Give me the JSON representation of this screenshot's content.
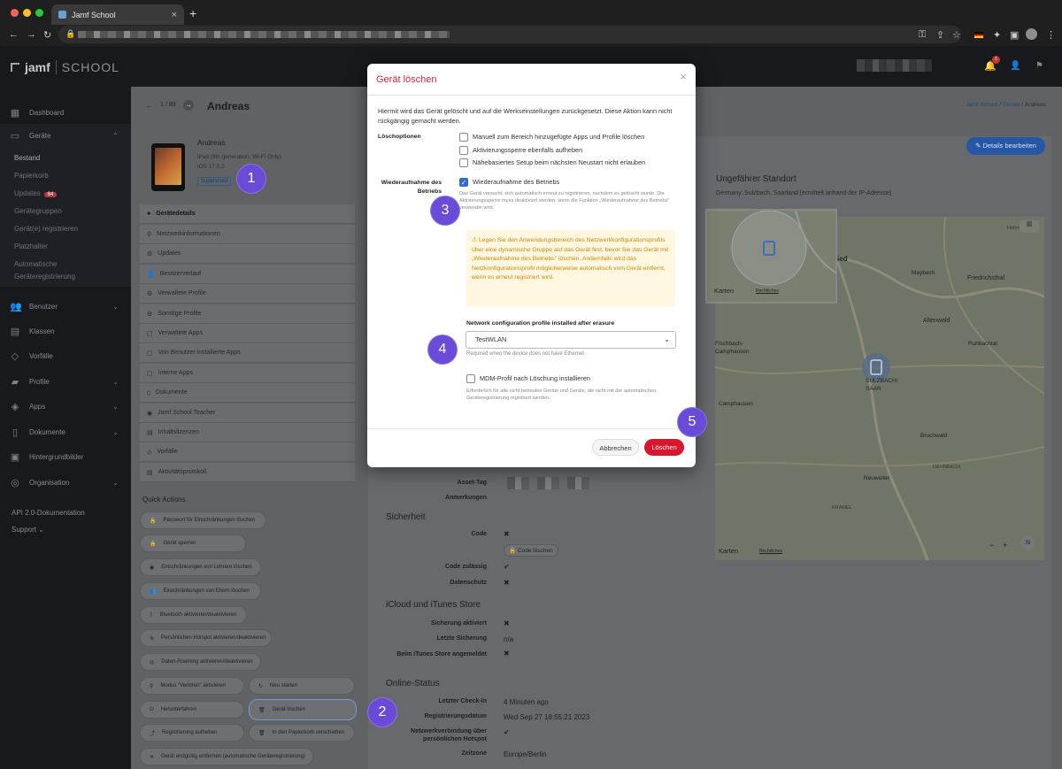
{
  "browser": {
    "tab_title": "Jamf School",
    "close": "×",
    "new_tab": "+"
  },
  "app": {
    "logo_jamf": "jamf",
    "logo_school": "SCHOOL",
    "notifications": "1"
  },
  "sidebar": {
    "items": [
      {
        "label": "Dashboard",
        "icon": "grid-icon"
      },
      {
        "label": "Geräte",
        "icon": "monitor-icon"
      },
      {
        "label": "Benutzer",
        "icon": "users-icon"
      },
      {
        "label": "Klassen",
        "icon": "book-icon"
      },
      {
        "label": "Vorfälle",
        "icon": "tag-icon"
      },
      {
        "label": "Profile",
        "icon": "folder-icon"
      },
      {
        "label": "Apps",
        "icon": "layers-icon"
      },
      {
        "label": "Dokumente",
        "icon": "document-icon"
      },
      {
        "label": "Hintergrundbilder",
        "icon": "image-icon"
      },
      {
        "label": "Organisation",
        "icon": "globe-icon"
      }
    ],
    "sub": [
      "Bestand",
      "Papierkorb",
      "Updates",
      "Gerätegruppen",
      "Gerät(e) registrieren",
      "Platzhalter",
      "Automatische",
      "Geräteregistrierung"
    ],
    "updates_badge": "84",
    "api_docs": "API 2.0-Dokumentation",
    "support": "Support"
  },
  "device": {
    "pager": "1 / 89",
    "name": "Andreas",
    "name_small": "Andreas",
    "model": "iPad (8th generation, Wi-Fi Only)",
    "ios": "iOS 17.0.2",
    "supervised": "Supervised",
    "breadcrumb": [
      "Jamf School",
      "Geräte",
      "Andreas"
    ],
    "edit_button": "Details bearbeiten"
  },
  "device_menu": [
    "Gerätedetails",
    "Netzwerkinformationen",
    "Updates",
    "Besitzerverlauf",
    "Verwaltete Profile",
    "Sonstige Profile",
    "Verwaltete Apps",
    "Von Benutzer installierte Apps",
    "Interne Apps",
    "Dokumente",
    "Jamf School Teacher",
    "Inhaltslizenzen",
    "Vorfälle",
    "Aktivitätsprotokoll"
  ],
  "quick_actions": {
    "title": "Quick Actions",
    "items": [
      "Passwort für Einschränkungen löschen",
      "Gerät sperren",
      "Einschränkungen von Lehrern löschen",
      "Einschränkungen von Eltern löschen",
      "Bluetooth aktivieren/deaktivieren",
      "Persönlichen Hotspot aktivieren/deaktivieren",
      "Daten-Roaming aktivieren/deaktivieren",
      "Modus \"Verloren\" aktivieren",
      "Neu starten",
      "Herunterfahren",
      "Gerät löschen",
      "Registrierung aufheben",
      "In den Papierkorb verschieben",
      "Gerät endgültig entfernen (automatische Geräteregistrierung)"
    ]
  },
  "details": {
    "asset_tag": "Asset-Tag",
    "notes": "Anmerkungen",
    "security_title": "Sicherheit",
    "code": "Code",
    "code_delete": "Code löschen",
    "code_allowed": "Code zulässig",
    "privacy": "Datenschutz",
    "icloud_title": "iCloud und iTunes Store",
    "backup_active": "Sicherung aktiviert",
    "last_backup": "Letzte Sicherung",
    "last_backup_val": "n/a",
    "itunes_logged": "Beim iTunes Store angemeldet",
    "online_title": "Online-Status",
    "last_checkin": "Letzter Check-In",
    "last_checkin_val": "4 Minuten ago",
    "reg_date": "Registrierungsdatum",
    "reg_date_val": "Wed Sep 27 18:55:21 2023",
    "hotspot": "Netzwerkverbindung über persönlichen Hotspot",
    "timezone": "Zeitzone",
    "timezone_val": "Europe/Berlin"
  },
  "map": {
    "title": "Ungefährer Standort",
    "subtitle": "Germany, Sulzbach, Saarland (ermittelt anhand der IP-Adresse)",
    "labels": [
      "Maybach",
      "Friedrichsthal",
      "Altenwald",
      "Fischbach-",
      "Camphausen",
      "Ruhbachtal",
      "SULZBACH/",
      "SAAR",
      "Camphausen",
      "Bruchwald",
      "Neuweiler",
      "GEHNBACH",
      "KRÄMEL",
      "Hofenko",
      "ied"
    ],
    "apple_maps": "Karten",
    "legal": "Rechtliches"
  },
  "modal": {
    "title": "Gerät löschen",
    "intro": "Hiermit wird das Gerät gelöscht und auf die Werkseinstellungen zurückgesetzt. Diese Aktion kann nicht rückgängig gemacht werden.",
    "options_label": "Löschoptionen",
    "opt1": "Manuell zum Bereich hinzugefügte Apps und Profile löschen",
    "opt2": "Aktivierungssperre ebenfalls aufheben",
    "opt3": "Nähebasiertes Setup beim nächsten Neustart nicht erlauben",
    "resume_label": "Wiederaufnahme des Betriebs",
    "resume_opt": "Wiederaufnahme des Betriebs",
    "resume_help": "Das Gerät versucht, sich automatisch erneut zu registrieren, nachdem es gelöscht wurde. Die Aktivierungssperre muss deaktiviert werden, wenn die Funktion „Wiederaufnahme des Betriebs\" verwendet wird.",
    "warning": "Legen Sie den Anwendungsbereich des Netzwerkkonfigurationsprofils über eine dynamische Gruppe auf das Gerät fest, bevor Sie das Gerät mit „Wiederaufnahme des Betriebs\" löschen. Andernfalls wird das Netzkonfigurationsprofil möglicherweise automatisch vom Gerät entfernt, wenn es erneut registriert wird.",
    "network_label": "Network configuration profile installed after erasure",
    "network_value": "TestWLAN",
    "network_help": "Required when the device does not have Ethernet",
    "mdm_opt": "MDM-Profil nach Löschung installieren",
    "mdm_help": "Erforderlich für alle nicht betreuten Geräte und Geräte, die nicht mit der automatischen Geräteregistrierung registriert werden.",
    "cancel": "Abbrechen",
    "delete": "Löschen"
  },
  "steps": [
    "1",
    "2",
    "3",
    "4",
    "5"
  ]
}
